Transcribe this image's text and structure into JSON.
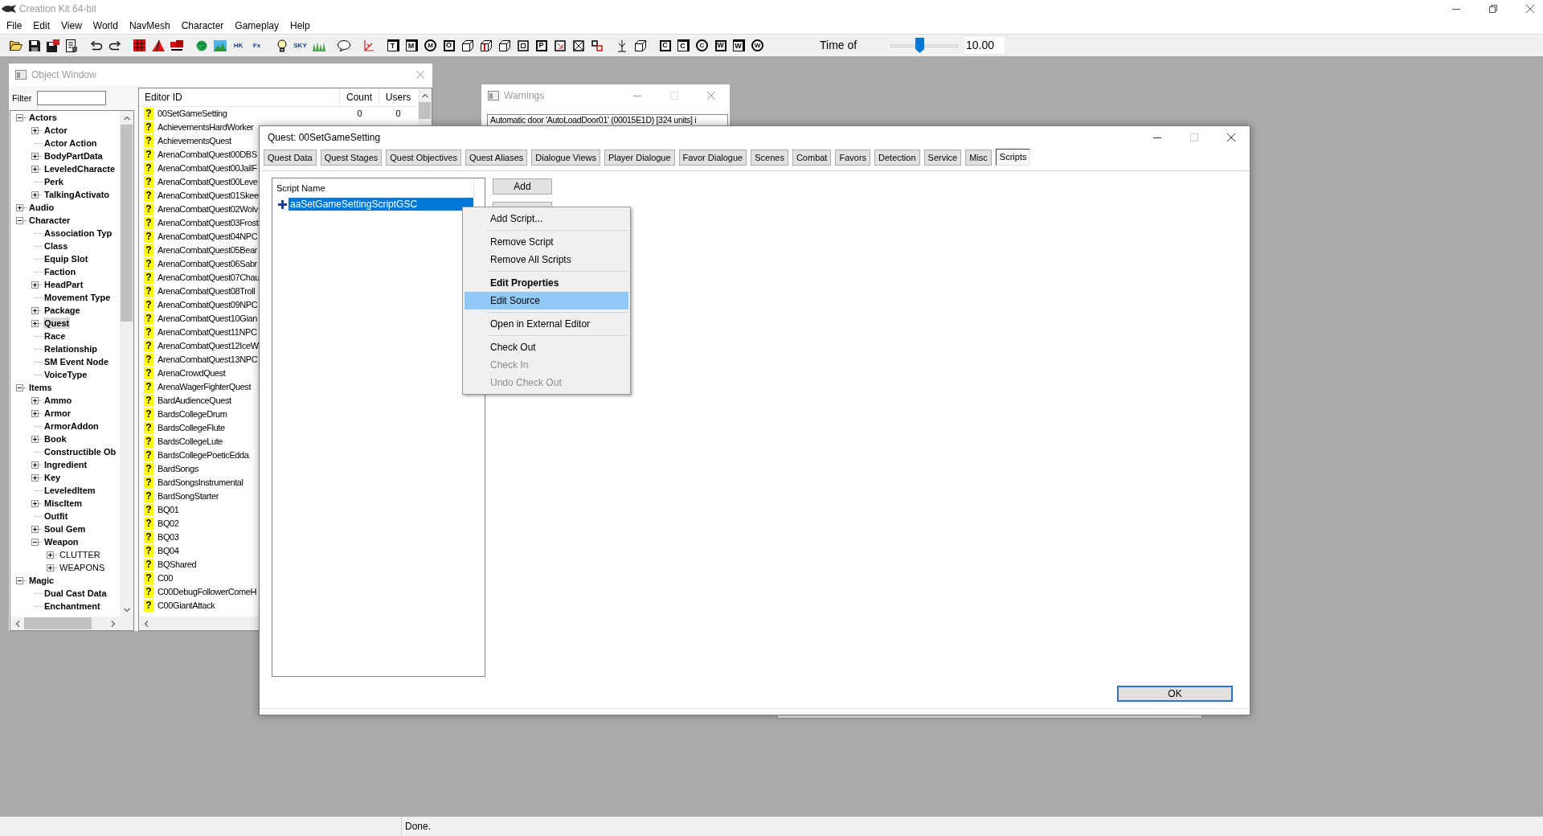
{
  "app_title": "Creation Kit 64-bit",
  "menu": [
    "File",
    "Edit",
    "View",
    "World",
    "NavMesh",
    "Character",
    "Gameplay",
    "Help"
  ],
  "toolbar": [
    {
      "kind": "open"
    },
    {
      "kind": "save"
    },
    {
      "kind": "save-all"
    },
    {
      "kind": "document"
    },
    {
      "kind": "separator"
    },
    {
      "kind": "undo"
    },
    {
      "kind": "redo"
    },
    {
      "kind": "separator"
    },
    {
      "kind": "grid"
    },
    {
      "kind": "triangle"
    },
    {
      "kind": "blocks"
    },
    {
      "kind": "separator"
    },
    {
      "kind": "globe"
    },
    {
      "kind": "landscape"
    },
    {
      "kind": "label",
      "glyph": "HK"
    },
    {
      "kind": "label",
      "glyph": "Fx"
    },
    {
      "kind": "separator"
    },
    {
      "kind": "bulb"
    },
    {
      "kind": "label",
      "glyph": "SKY"
    },
    {
      "kind": "grass"
    },
    {
      "kind": "separator"
    },
    {
      "kind": "bubble"
    },
    {
      "kind": "separator"
    },
    {
      "kind": "axes"
    },
    {
      "kind": "separator"
    },
    {
      "kind": "letter-cube",
      "glyph": "T"
    },
    {
      "kind": "letter-cube",
      "glyph": "M"
    },
    {
      "kind": "letter-circle",
      "glyph": "M"
    },
    {
      "kind": "letter-square",
      "glyph": "O"
    },
    {
      "kind": "cube"
    },
    {
      "kind": "cube-bar"
    },
    {
      "kind": "cube"
    },
    {
      "kind": "small-square"
    },
    {
      "kind": "letter-square",
      "glyph": "P"
    },
    {
      "kind": "square-arrow"
    },
    {
      "kind": "crossed-box"
    },
    {
      "kind": "link"
    },
    {
      "kind": "separator"
    },
    {
      "kind": "antenna"
    },
    {
      "kind": "cube"
    },
    {
      "kind": "separator"
    },
    {
      "kind": "letter-square",
      "glyph": "C"
    },
    {
      "kind": "letter-cube",
      "glyph": "C"
    },
    {
      "kind": "letter-circle",
      "glyph": "C"
    },
    {
      "kind": "letter-square",
      "glyph": "W"
    },
    {
      "kind": "letter-cube",
      "glyph": "W"
    },
    {
      "kind": "letter-circle",
      "glyph": "W"
    }
  ],
  "time_control": {
    "label": "Time of",
    "level": 0.42,
    "value": "10.00"
  },
  "object_window": {
    "title": "Object Window",
    "filter_label": "Filter",
    "tree": [
      {
        "label": "Actors",
        "expanded": true,
        "selected": false,
        "children": [
          {
            "label": "Actor",
            "expanded": false,
            "selected": false
          },
          {
            "label": "Actor Action",
            "selected": false
          },
          {
            "label": "BodyPartData",
            "expanded": false,
            "selected": false
          },
          {
            "label": "LeveledCharacte",
            "expanded": false,
            "selected": false
          },
          {
            "label": "Perk",
            "selected": false
          },
          {
            "label": "TalkingActivato",
            "expanded": false,
            "selected": false
          }
        ]
      },
      {
        "label": "Audio",
        "expanded": false,
        "selected": false
      },
      {
        "label": "Character",
        "expanded": true,
        "selected": false,
        "children": [
          {
            "label": "Association Typ",
            "selected": false
          },
          {
            "label": "Class",
            "selected": false
          },
          {
            "label": "Equip Slot",
            "selected": false
          },
          {
            "label": "Faction",
            "selected": false
          },
          {
            "label": "HeadPart",
            "expanded": false,
            "selected": false
          },
          {
            "label": "Movement Type",
            "selected": false
          },
          {
            "label": "Package",
            "expanded": false,
            "selected": false
          },
          {
            "label": "Quest",
            "expanded": false,
            "selected": true
          },
          {
            "label": "Race",
            "selected": false
          },
          {
            "label": "Relationship",
            "selected": false
          },
          {
            "label": "SM Event Node",
            "selected": false
          },
          {
            "label": "VoiceType",
            "selected": false
          }
        ]
      },
      {
        "label": "Items",
        "expanded": true,
        "selected": false,
        "children": [
          {
            "label": "Ammo",
            "expanded": false,
            "selected": false
          },
          {
            "label": "Armor",
            "expanded": false,
            "selected": false
          },
          {
            "label": "ArmorAddon",
            "selected": false
          },
          {
            "label": "Book",
            "expanded": false,
            "selected": false
          },
          {
            "label": "Constructible Ob",
            "selected": false
          },
          {
            "label": "Ingredient",
            "expanded": false,
            "selected": false
          },
          {
            "label": "Key",
            "expanded": false,
            "selected": false
          },
          {
            "label": "LeveledItem",
            "selected": false
          },
          {
            "label": "MiscItem",
            "expanded": false,
            "selected": false
          },
          {
            "label": "Outfit",
            "selected": false
          },
          {
            "label": "Soul Gem",
            "expanded": false,
            "selected": false
          },
          {
            "label": "Weapon",
            "expanded": true,
            "selected": false,
            "children": [
              {
                "label": "CLUTTER",
                "expanded": false,
                "selected": false
              },
              {
                "label": "WEAPONS",
                "expanded": false,
                "selected": false
              }
            ]
          }
        ]
      },
      {
        "label": "Magic",
        "expanded": true,
        "selected": false,
        "children": [
          {
            "label": "Dual Cast Data",
            "selected": false
          },
          {
            "label": "Enchantment",
            "selected": false
          }
        ]
      }
    ],
    "columns": [
      "Editor ID",
      "Count",
      "Users"
    ],
    "rows": [
      {
        "mark": "?",
        "editor_id": "00SetGameSetting",
        "count": "0",
        "users": "0"
      },
      {
        "mark": "?",
        "editor_id": "AchievementsHardWorker"
      },
      {
        "mark": "?",
        "editor_id": "AchievementsQuest"
      },
      {
        "mark": "?",
        "editor_id": "ArenaCombatQuest00DBS"
      },
      {
        "mark": "?",
        "editor_id": "ArenaCombatQuest00JailF"
      },
      {
        "mark": "?",
        "editor_id": "ArenaCombatQuest00Leve"
      },
      {
        "mark": "?",
        "editor_id": "ArenaCombatQuest01Skee"
      },
      {
        "mark": "?",
        "editor_id": "ArenaCombatQuest02Wolv"
      },
      {
        "mark": "?",
        "editor_id": "ArenaCombatQuest03Frost"
      },
      {
        "mark": "?",
        "editor_id": "ArenaCombatQuest04NPC"
      },
      {
        "mark": "?",
        "editor_id": "ArenaCombatQuest05Bear"
      },
      {
        "mark": "?",
        "editor_id": "ArenaCombatQuest06Sabr"
      },
      {
        "mark": "?",
        "editor_id": "ArenaCombatQuest07Chau"
      },
      {
        "mark": "?",
        "editor_id": "ArenaCombatQuest08Troll"
      },
      {
        "mark": "?",
        "editor_id": "ArenaCombatQuest09NPC"
      },
      {
        "mark": "?",
        "editor_id": "ArenaCombatQuest10Gian"
      },
      {
        "mark": "?",
        "editor_id": "ArenaCombatQuest11NPC"
      },
      {
        "mark": "?",
        "editor_id": "ArenaCombatQuest12IceW"
      },
      {
        "mark": "?",
        "editor_id": "ArenaCombatQuest13NPC"
      },
      {
        "mark": "?",
        "editor_id": "ArenaCrowdQuest"
      },
      {
        "mark": "?",
        "editor_id": "ArenaWagerFighterQuest"
      },
      {
        "mark": "?",
        "editor_id": "BardAudienceQuest"
      },
      {
        "mark": "?",
        "editor_id": "BardsCollegeDrum"
      },
      {
        "mark": "?",
        "editor_id": "BardsCollegeFlute"
      },
      {
        "mark": "?",
        "editor_id": "BardsCollegeLute"
      },
      {
        "mark": "?",
        "editor_id": "BardsCollegePoeticEdda"
      },
      {
        "mark": "?",
        "editor_id": "BardSongs"
      },
      {
        "mark": "?",
        "editor_id": "BardSongsInstrumental"
      },
      {
        "mark": "?",
        "editor_id": "BardSongStarter"
      },
      {
        "mark": "?",
        "editor_id": "BQ01"
      },
      {
        "mark": "?",
        "editor_id": "BQ02"
      },
      {
        "mark": "?",
        "editor_id": "BQ03"
      },
      {
        "mark": "?",
        "editor_id": "BQ04"
      },
      {
        "mark": "?",
        "editor_id": "BQShared"
      },
      {
        "mark": "?",
        "editor_id": "C00"
      },
      {
        "mark": "?",
        "editor_id": "C00DebugFollowerComeH"
      },
      {
        "mark": "?",
        "editor_id": "C00GiantAttack"
      }
    ]
  },
  "warnings_window": {
    "title": "Warnings",
    "messages": [
      "Automatic door 'AutoLoadDoor01' (00015E1D) [324 units] i"
    ]
  },
  "quest_window": {
    "title": "Quest: 00SetGameSetting",
    "tabs": [
      {
        "label": "Quest Data",
        "selected": false
      },
      {
        "label": "Quest Stages",
        "selected": false
      },
      {
        "label": "Quest Objectives",
        "selected": false
      },
      {
        "label": "Quest Aliases",
        "selected": false
      },
      {
        "label": "Dialogue Views",
        "selected": false
      },
      {
        "label": "Player Dialogue",
        "selected": false
      },
      {
        "label": "Favor Dialogue",
        "selected": false
      },
      {
        "label": "Scenes",
        "selected": false
      },
      {
        "label": "Combat",
        "selected": false
      },
      {
        "label": "Favors",
        "selected": false
      },
      {
        "label": "Detection",
        "selected": false
      },
      {
        "label": "Service",
        "selected": false
      },
      {
        "label": "Misc",
        "selected": false
      },
      {
        "label": "Scripts",
        "selected": true
      }
    ],
    "script_column": "Script Name",
    "scripts": [
      {
        "name": "aaSetGameSettingScriptGSC",
        "selected": true
      }
    ],
    "buttons": [
      "Add"
    ],
    "ok": "OK"
  },
  "context_menu": [
    {
      "kind": "item",
      "label": "Add Script...",
      "default": false,
      "selected": false,
      "disabled": false
    },
    {
      "kind": "separator"
    },
    {
      "kind": "item",
      "label": "Remove Script",
      "default": false,
      "selected": false,
      "disabled": false
    },
    {
      "kind": "item",
      "label": "Remove All Scripts",
      "default": false,
      "selected": false,
      "disabled": false
    },
    {
      "kind": "separator"
    },
    {
      "kind": "item",
      "label": "Edit Properties",
      "default": true,
      "selected": false,
      "disabled": false
    },
    {
      "kind": "item",
      "label": "Edit Source",
      "default": false,
      "selected": true,
      "disabled": false
    },
    {
      "kind": "separator"
    },
    {
      "kind": "item",
      "label": "Open in External Editor",
      "default": false,
      "selected": false,
      "disabled": false
    },
    {
      "kind": "separator"
    },
    {
      "kind": "item",
      "label": "Check Out",
      "default": false,
      "selected": false,
      "disabled": false
    },
    {
      "kind": "item",
      "label": "Check In",
      "default": false,
      "selected": false,
      "disabled": true
    },
    {
      "kind": "item",
      "label": "Undo Check Out",
      "default": false,
      "selected": false,
      "disabled": true
    }
  ],
  "status_bar": {
    "text": "Done."
  }
}
